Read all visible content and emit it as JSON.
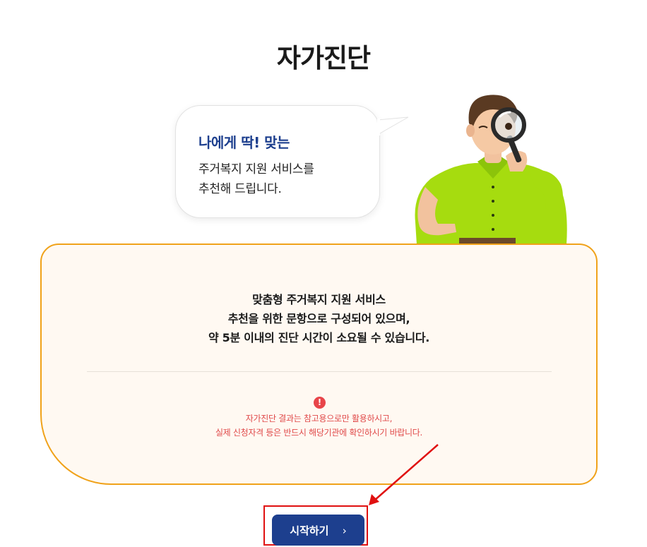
{
  "page": {
    "title": "자가진단"
  },
  "bubble": {
    "headline": "나에게 딱! 맞는",
    "lines": [
      "주거복지 지원 서비스를",
      "추천해 드립니다."
    ]
  },
  "card": {
    "lines": [
      "맞춤형 주거복지 지원 서비스",
      "추천을 위한 문항으로 구성되어 있으며,",
      "약 5분 이내의 진단 시간이 소요될 수 있습니다."
    ],
    "warning_icon": "!",
    "warning_lines": [
      "자가진단 결과는 참고용으로만 활용하시고,",
      "실제 신청자격 등은 반드시 해당기관에 확인하시기 바랍니다."
    ]
  },
  "start_button": {
    "label": "시작하기",
    "chevron": "›"
  },
  "colors": {
    "brand_navy": "#1d3f8e",
    "card_border": "#f0a21a",
    "card_bg": "#fff9f2",
    "warning_red": "#e04a4a",
    "annotation_red": "#e01010"
  },
  "icons": {
    "character": "man-with-magnifying-glass-illustration",
    "warning": "exclamation-circle-icon",
    "chevron": "chevron-right-icon"
  }
}
